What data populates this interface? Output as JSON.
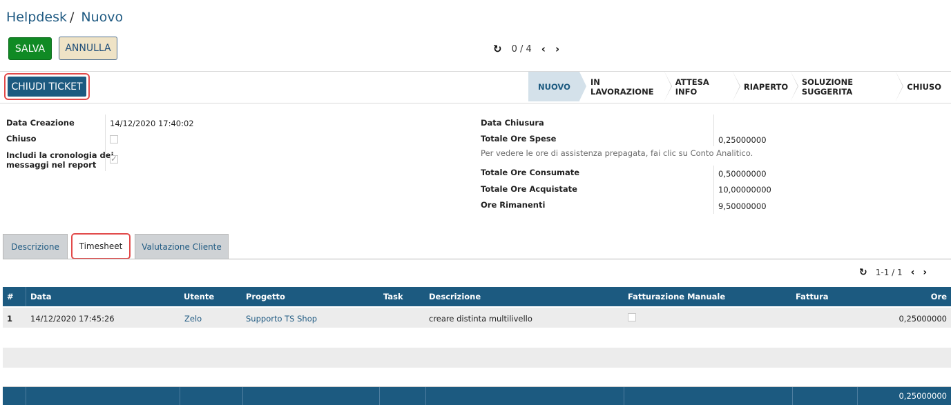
{
  "breadcrumb": {
    "parent": "Helpdesk",
    "separator": "/",
    "current": "Nuovo"
  },
  "toolbar": {
    "save_label": "SALVA",
    "cancel_label": "ANNULLA"
  },
  "pager": {
    "value": "0 / 4"
  },
  "actions": {
    "close_ticket_label": "CHIUDI TICKET"
  },
  "stages": [
    {
      "label": "NUOVO",
      "active": true
    },
    {
      "label": "IN LAVORAZIONE",
      "active": false
    },
    {
      "label": "ATTESA INFO",
      "active": false
    },
    {
      "label": "RIAPERTO",
      "active": false
    },
    {
      "label": "SOLUZIONE SUGGERITA",
      "active": false
    },
    {
      "label": "CHIUSO",
      "active": false
    }
  ],
  "form_left": {
    "data_creazione_label": "Data Creazione",
    "data_creazione_value": "14/12/2020 17:40:02",
    "chiuso_label": "Chiuso",
    "chiuso_checked": false,
    "includi_label_line1": "Includi la cronologia dei",
    "includi_label_line2": "messaggi nel report",
    "includi_checked": true
  },
  "form_right": {
    "data_chiusura_label": "Data Chiusura",
    "data_chiusura_value": "",
    "totale_ore_spese_label": "Totale Ore Spese",
    "totale_ore_spese_value": "0,25000000",
    "hint": "Per vedere le ore di assistenza prepagata, fai clic su Conto Analitico.",
    "totale_ore_consumate_label": "Totale Ore Consumate",
    "totale_ore_consumate_value": "0,50000000",
    "totale_ore_acquistate_label": "Totale Ore Acquistate",
    "totale_ore_acquistate_value": "10,00000000",
    "ore_rimanenti_label": "Ore Rimanenti",
    "ore_rimanenti_value": "9,50000000"
  },
  "tabs": [
    {
      "label": "Descrizione",
      "active": false
    },
    {
      "label": "Timesheet",
      "active": true
    },
    {
      "label": "Valutazione Cliente",
      "active": false
    }
  ],
  "subpager": {
    "value": "1-1 / 1"
  },
  "timesheet": {
    "columns": [
      "#",
      "Data",
      "Utente",
      "Progetto",
      "Task",
      "Descrizione",
      "Fatturazione Manuale",
      "Fattura",
      "Ore"
    ],
    "rows": [
      {
        "num": "1",
        "data": "14/12/2020 17:45:26",
        "utente": "Zelo",
        "progetto": "Supporto TS Shop",
        "task": "",
        "descrizione": "creare distinta multilivello",
        "fatturazione_manuale": false,
        "fattura": "",
        "ore": "0,25000000"
      }
    ],
    "total_ore": "0,25000000"
  },
  "colors": {
    "primary": "#1c5a80",
    "save": "#108a24",
    "cancel_bg": "#efe3c6",
    "highlight": "#e24a4a"
  },
  "icons": {
    "refresh": "refresh-icon",
    "prev": "chevron-left-icon",
    "next": "chevron-right-icon"
  }
}
